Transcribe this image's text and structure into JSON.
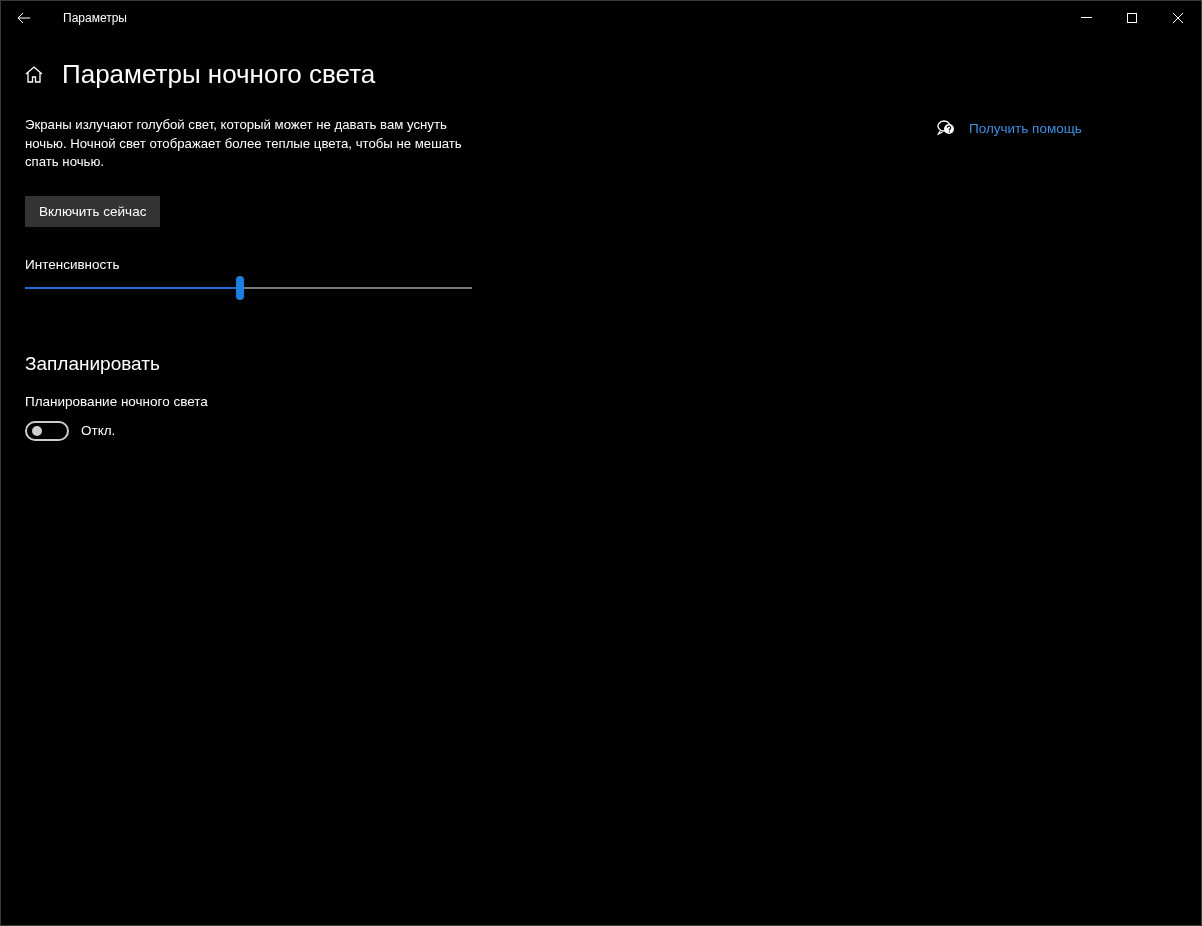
{
  "window": {
    "title": "Параметры"
  },
  "page": {
    "title": "Параметры ночного света"
  },
  "description": "Экраны излучают голубой свет, который может не давать вам уснуть ночью. Ночной свет отображает более теплые цвета, чтобы не мешать спать ночью.",
  "enable_button": "Включить сейчас",
  "intensity": {
    "label": "Интенсивность",
    "level": 0.48
  },
  "schedule": {
    "heading": "Запланировать",
    "label": "Планирование ночного света",
    "on": false,
    "state_text": "Откл."
  },
  "help_link": "Получить помощь"
}
